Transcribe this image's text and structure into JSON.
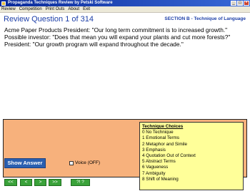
{
  "window": {
    "title": "Propaganda Techniques Review by Petski Software"
  },
  "menu": [
    "Review",
    "Competition",
    "Print Outs",
    "About",
    "Exit"
  ],
  "question": {
    "title": "Review Question 1 of 314",
    "section": "SECTION B - Technique of Language",
    "lines": [
      "Acme Paper Products President: \"Our long term commitment is to increased growth.\"",
      "Possible investor: \"Does that mean you will expand your plants and cut more forests?\"",
      "President: \"Our growth program will expand throughout the decade.\""
    ]
  },
  "choices": {
    "header": "Technique Choices",
    "items": [
      "0 No Technique",
      "1 Emotional Terms",
      "2 Metaphor and Simile",
      "3 Emphasis",
      "4 Quotation Out of Context",
      "5 Abstract Terms",
      "6 Vagueness",
      "7 Ambiguity",
      "8 Shift of Meaning"
    ]
  },
  "controls": {
    "show_answer": "Show Answer",
    "voice": "Voice (OFF)"
  },
  "nav": {
    "first": "<<",
    "prev": "<",
    "next": ">",
    "last": ">>",
    "random": "?! ?"
  }
}
